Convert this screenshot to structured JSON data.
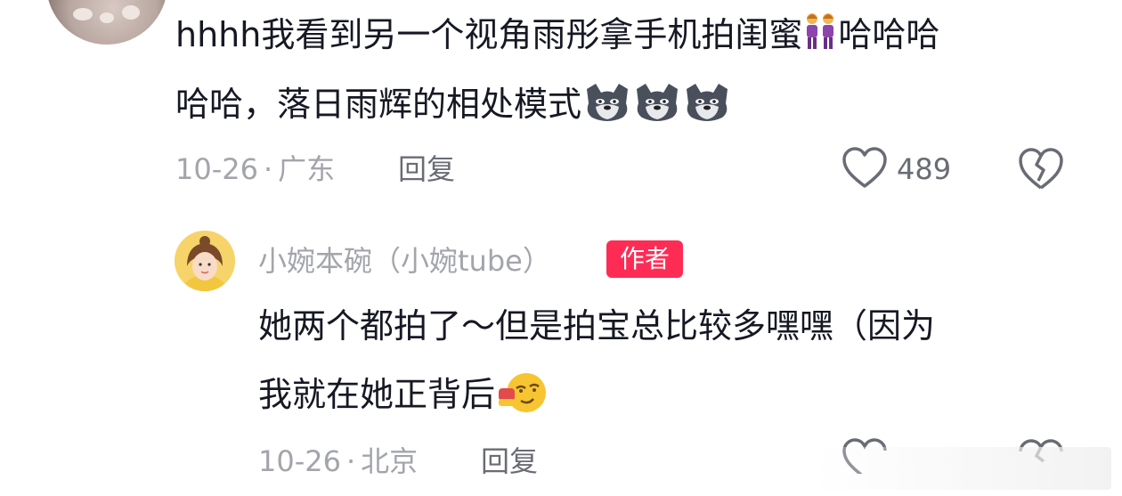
{
  "comment": {
    "text_line1_a": "hhhh我看到另一个视角雨彤拿手机拍闺蜜",
    "text_line1_b": "哈哈哈",
    "text_line2": "哈哈，落日雨辉的相处模式",
    "date": "10-26",
    "separator": "·",
    "location": "广东",
    "reply_label": "回复",
    "like_count": "489",
    "emojis": [
      "two-women-emoji",
      "wolf-emoji",
      "wolf-emoji",
      "wolf-emoji"
    ]
  },
  "reply": {
    "author_name": "小婉本碗（小婉tube）",
    "author_badge": "作者",
    "text_line1": "她两个都拍了～但是拍宝总比较多嘿嘿（因为",
    "text_line2": "我就在她正背后",
    "date": "10-26",
    "separator": "·",
    "location": "北京",
    "reply_label": "回复",
    "emojis": [
      "smirk-emoji"
    ]
  },
  "colors": {
    "text_primary": "#161823",
    "text_secondary": "#a3a5ab",
    "badge_bg": "#fe2c55",
    "icon_gray": "#6a6c74"
  }
}
